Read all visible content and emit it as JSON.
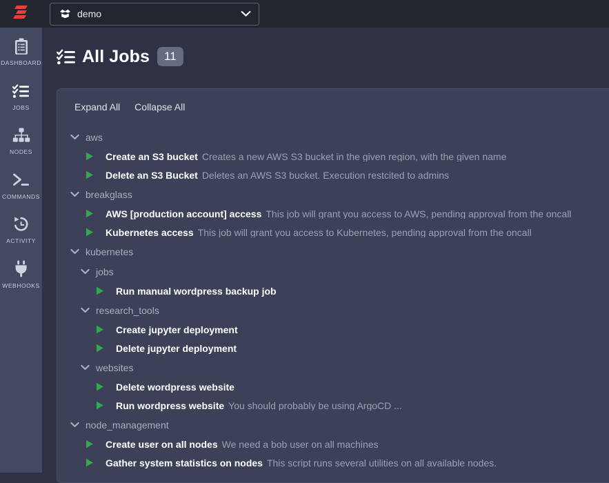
{
  "navbar": {
    "logo_icon": "rundeck-logo-icon",
    "logo_color": "#e8413a",
    "project_selector": {
      "icon": "open-box-icon",
      "value": "demo",
      "caret_icon": "chevron-down-icon"
    }
  },
  "sidebar": {
    "items": [
      {
        "label": "DASHBOARD",
        "icon": "clipboard-list-icon"
      },
      {
        "label": "JOBS",
        "icon": "checklist-icon"
      },
      {
        "label": "NODES",
        "icon": "sitemap-icon"
      },
      {
        "label": "COMMANDS",
        "icon": "terminal-icon"
      },
      {
        "label": "ACTIVITY",
        "icon": "history-clock-icon"
      },
      {
        "label": "WEBHOOKS",
        "icon": "plug-icon"
      }
    ]
  },
  "page": {
    "icon": "checklist-icon",
    "title": "All Jobs",
    "count": "11"
  },
  "toolbar": {
    "expand_all": "Expand All",
    "collapse_all": "Collapse All"
  },
  "colors": {
    "accent_red": "#e8413a",
    "play_green": "#33a852",
    "card_bg": "#3c4158",
    "page_bg": "#2e3244",
    "navbar_bg": "#23262f",
    "rail_bg": "#434961",
    "badge_bg": "#656b83"
  },
  "tree": [
    {
      "type": "group",
      "level": 1,
      "name": "aws",
      "chevron": "chevron-down-icon",
      "children": [
        {
          "type": "job",
          "level": 1,
          "name": "Create an S3 bucket",
          "desc": "Creates a new AWS S3 bucket in the given region, with the given name"
        },
        {
          "type": "job",
          "level": 1,
          "name": "Delete an S3 Bucket",
          "desc": "Deletes an AWS S3 bucket. Execution restcited to admins"
        }
      ]
    },
    {
      "type": "group",
      "level": 1,
      "name": "breakglass",
      "chevron": "chevron-down-icon",
      "children": [
        {
          "type": "job",
          "level": 1,
          "name": "AWS [production account] access",
          "desc": "This job will grant you access to AWS, pending approval from the oncall"
        },
        {
          "type": "job",
          "level": 1,
          "name": "Kubernetes access",
          "desc": "This job will grant you access to Kubernetes, pending approval from the oncall"
        }
      ]
    },
    {
      "type": "group",
      "level": 1,
      "name": "kubernetes",
      "chevron": "chevron-down-icon",
      "children": [
        {
          "type": "group",
          "level": 2,
          "name": "jobs",
          "chevron": "chevron-down-icon",
          "children": [
            {
              "type": "job",
              "level": 2,
              "name": "Run manual wordpress backup job",
              "desc": ""
            }
          ]
        },
        {
          "type": "group",
          "level": 2,
          "name": "research_tools",
          "chevron": "chevron-down-icon",
          "children": [
            {
              "type": "job",
              "level": 2,
              "name": "Create jupyter deployment",
              "desc": ""
            },
            {
              "type": "job",
              "level": 2,
              "name": "Delete jupyter deployment",
              "desc": ""
            }
          ]
        },
        {
          "type": "group",
          "level": 2,
          "name": "websites",
          "chevron": "chevron-down-icon",
          "children": [
            {
              "type": "job",
              "level": 2,
              "name": "Delete wordpress website",
              "desc": ""
            },
            {
              "type": "job",
              "level": 2,
              "name": "Run wordpress website",
              "desc": "You should probably be using ArgoCD ..."
            }
          ]
        }
      ]
    },
    {
      "type": "group",
      "level": 1,
      "name": "node_management",
      "chevron": "chevron-down-icon",
      "children": [
        {
          "type": "job",
          "level": 1,
          "name": "Create user on all nodes",
          "desc": "We need a bob user on all machines"
        },
        {
          "type": "job",
          "level": 1,
          "name": "Gather system statistics on nodes",
          "desc": "This script runs several utilities on all available nodes."
        }
      ]
    }
  ]
}
